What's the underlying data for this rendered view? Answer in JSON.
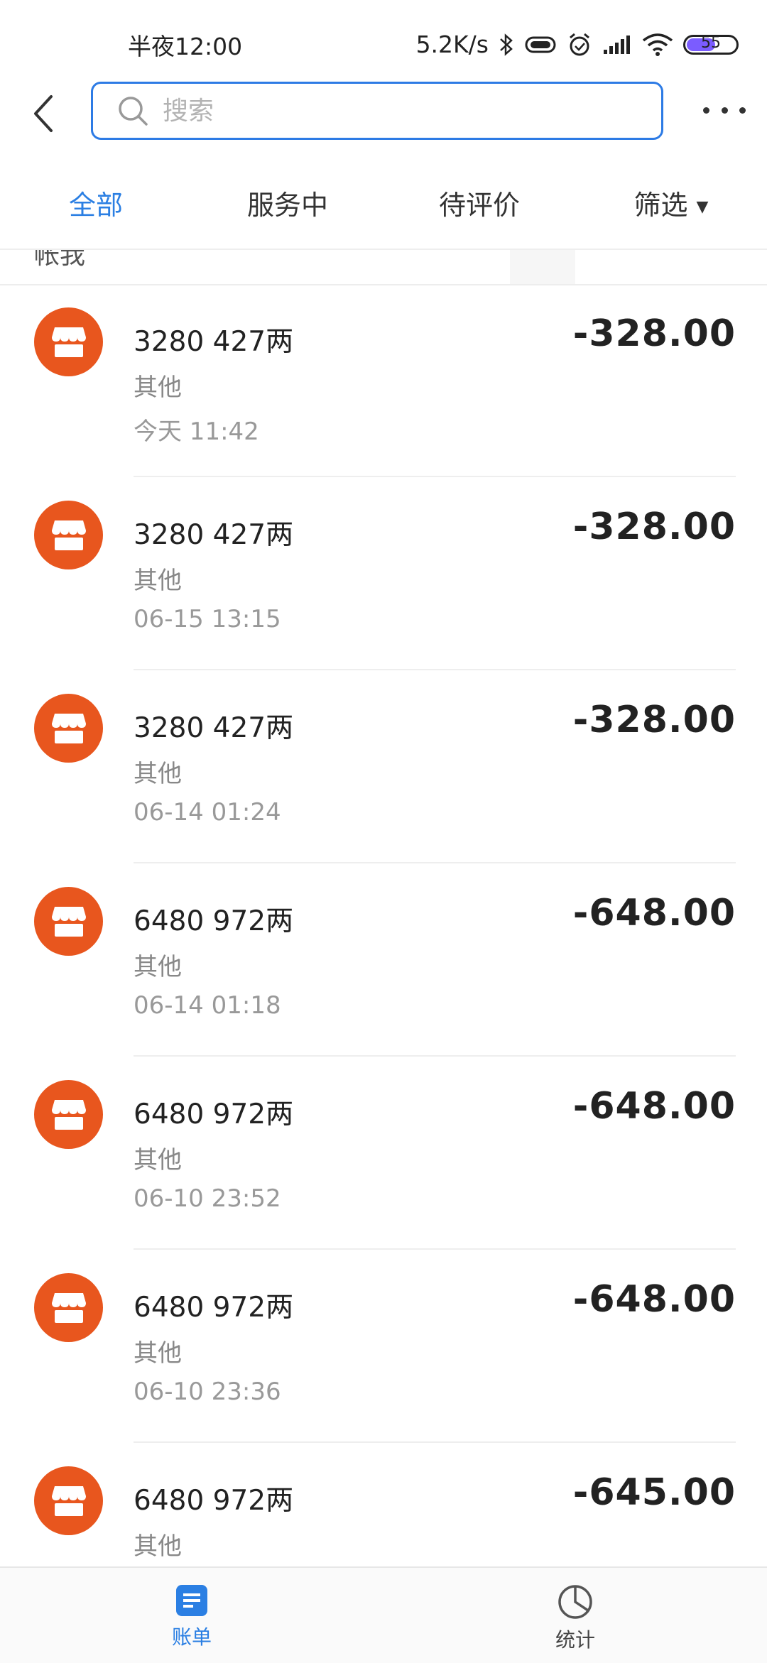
{
  "status_bar": {
    "time": "半夜12:00",
    "net_speed": "5.2K/s",
    "battery": "55",
    "colors": {
      "battery_fill": "#7b5cff"
    }
  },
  "search": {
    "placeholder": "搜索"
  },
  "tabs": [
    {
      "label": "全部",
      "active": true
    },
    {
      "label": "服务中",
      "active": false
    },
    {
      "label": "待评价",
      "active": false
    },
    {
      "label": "筛选",
      "active": false
    }
  ],
  "partial_header_text": "帐我",
  "bills": [
    {
      "title": "3280 427两",
      "category": "其他",
      "time": "今天  11:42",
      "amount": "-328.00"
    },
    {
      "title": "3280 427两",
      "category": "其他",
      "time": "06-15  13:15",
      "amount": "-328.00"
    },
    {
      "title": "3280 427两",
      "category": "其他",
      "time": "06-14  01:24",
      "amount": "-328.00"
    },
    {
      "title": "6480 972两",
      "category": "其他",
      "time": "06-14  01:18",
      "amount": "-648.00"
    },
    {
      "title": "6480 972两",
      "category": "其他",
      "time": "06-10  23:52",
      "amount": "-648.00"
    },
    {
      "title": "6480 972两",
      "category": "其他",
      "time": "06-10  23:36",
      "amount": "-648.00"
    },
    {
      "title": "6480 972两",
      "category": "其他",
      "time": "",
      "amount": "-645.00"
    }
  ],
  "bottom_nav": [
    {
      "label": "账单",
      "icon": "bill-icon",
      "active": true
    },
    {
      "label": "统计",
      "icon": "pie-chart-icon",
      "active": false
    }
  ],
  "colors": {
    "accent": "#2b7fe3",
    "merchant_icon_bg": "#e8561e"
  }
}
